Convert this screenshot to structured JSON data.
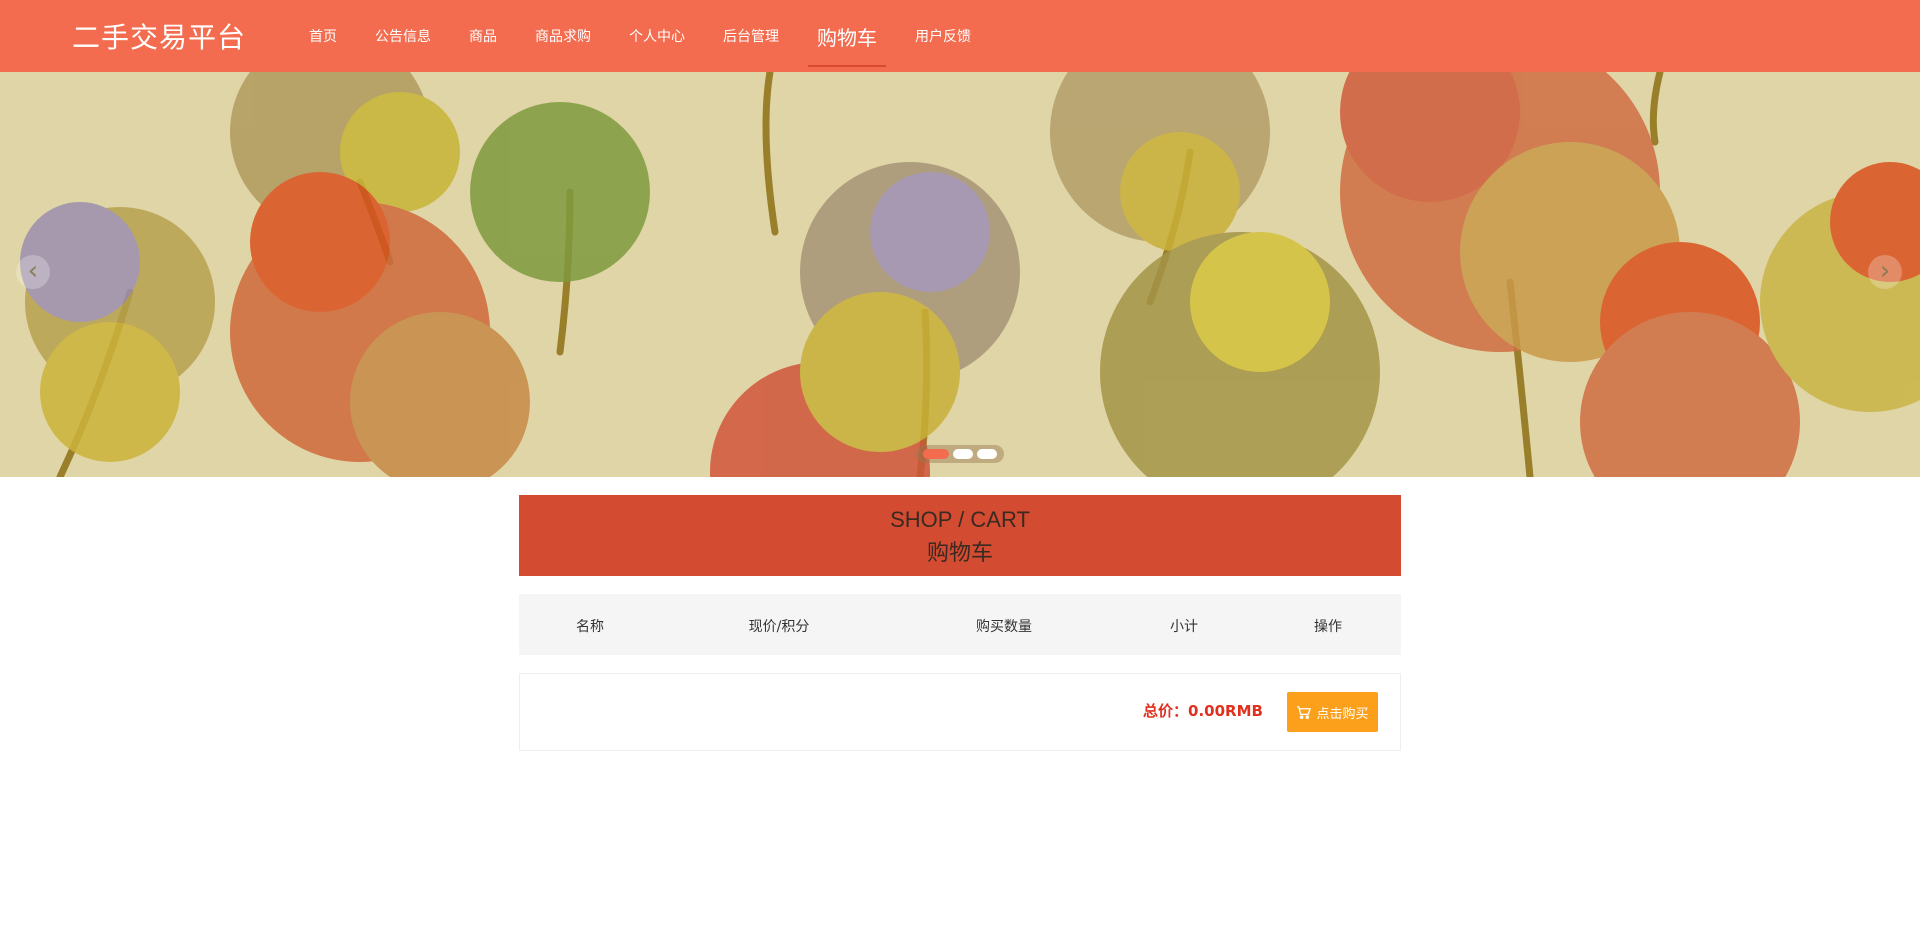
{
  "header": {
    "brand": "二手交易平台",
    "nav": [
      {
        "label": "首页",
        "active": false
      },
      {
        "label": "公告信息",
        "active": false
      },
      {
        "label": "商品",
        "active": false
      },
      {
        "label": "商品求购",
        "active": false
      },
      {
        "label": "个人中心",
        "active": false
      },
      {
        "label": "后台管理",
        "active": false
      },
      {
        "label": "购物车",
        "active": true
      },
      {
        "label": "用户反馈",
        "active": false
      }
    ],
    "color": "#f36c4f"
  },
  "banner": {
    "icons": {
      "prev": "chevron-left-icon",
      "next": "chevron-right-icon"
    },
    "slides_count": 3,
    "active_slide": 1
  },
  "cart": {
    "title_en": "SHOP / CART",
    "title_cn": "购物车",
    "columns": [
      "名称",
      "现价/积分",
      "购买数量",
      "小计",
      "操作"
    ],
    "items": [],
    "total_label": "总价：",
    "total_value": "0.00RMB",
    "buy_label": "点击购买",
    "buy_icon": "cart-icon",
    "colors": {
      "title_bg": "#d34b30",
      "total": "#e0301e",
      "buy_button": "#fc9f1b"
    }
  }
}
